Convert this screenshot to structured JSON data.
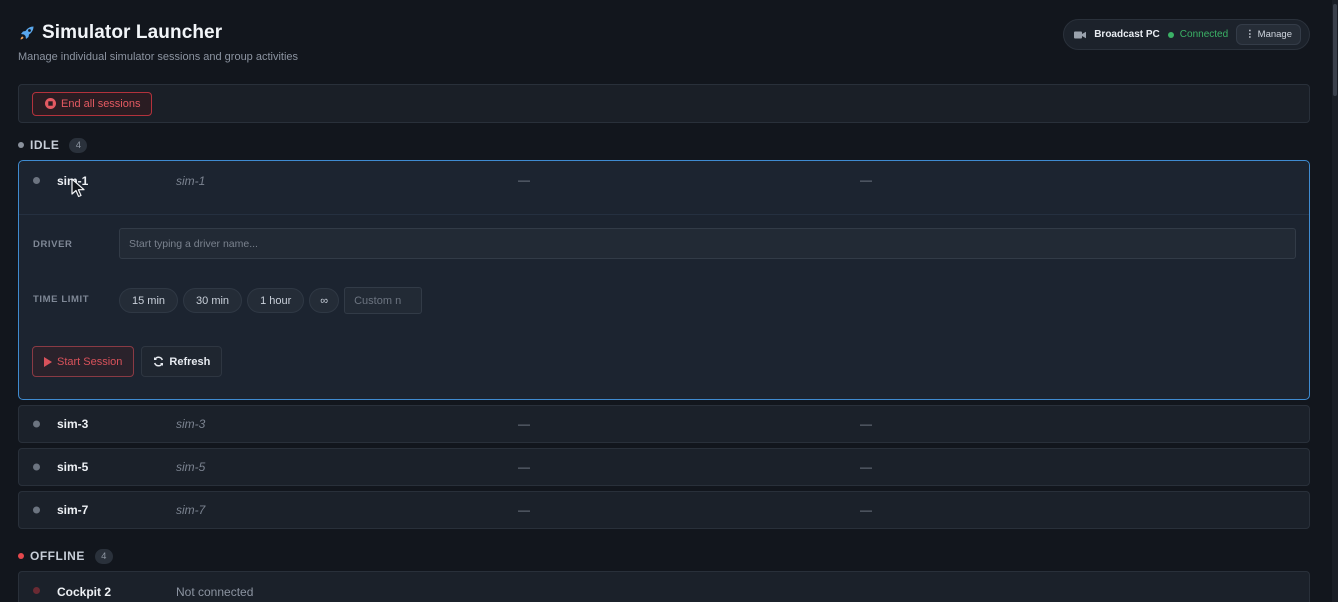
{
  "header": {
    "title": "Simulator Launcher",
    "subtitle": "Manage individual simulator sessions and group activities",
    "title_icon": "rocket-icon",
    "broadcast": {
      "name": "Broadcast PC",
      "status": "Connected",
      "status_color": "#3bb266",
      "manage_label": "Manage",
      "icon": "video-camera-icon"
    }
  },
  "toolbar": {
    "end_all_label": "End all sessions",
    "end_all_icon": "stop-circle-icon"
  },
  "sections": {
    "idle": {
      "label": "IDLE",
      "count": "4",
      "color": "#8a919c"
    },
    "offline": {
      "label": "OFFLINE",
      "count": "4",
      "color": "#e5484d"
    }
  },
  "expanded_sim": {
    "name": "sim-1",
    "id": "sim-1",
    "col3": "—",
    "col4": "—",
    "driver_label": "DRIVER",
    "driver_placeholder": "Start typing a driver name...",
    "time_limit_label": "TIME LIMIT",
    "time_options": [
      "15 min",
      "30 min",
      "1 hour",
      "∞"
    ],
    "custom_placeholder": "Custom n",
    "start_label": "Start Session",
    "refresh_label": "Refresh"
  },
  "idle_sims": [
    {
      "name": "sim-3",
      "id": "sim-3",
      "col3": "—",
      "col4": "—"
    },
    {
      "name": "sim-5",
      "id": "sim-5",
      "col3": "—",
      "col4": "—"
    },
    {
      "name": "sim-7",
      "id": "sim-7",
      "col3": "—",
      "col4": "—"
    }
  ],
  "offline_sims": [
    {
      "name": "Cockpit 2",
      "status": "Not connected"
    }
  ],
  "colors": {
    "accent": "#3f8bd0",
    "danger": "#e45a62",
    "background": "#12161d"
  }
}
